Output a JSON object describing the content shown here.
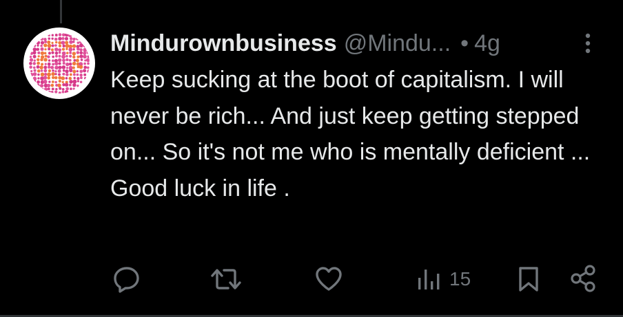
{
  "tweet": {
    "author_name": "Mindurownbusiness",
    "author_handle": "@Mindu...",
    "separator": "•",
    "timestamp": "4g",
    "text": "Keep sucking at the boot of capitalism. I will never be rich... And just keep getting stepped on... So it's not me who is mentally deficient ... Good luck in life ."
  },
  "avatar": {
    "description_icon": "color-blindness-test-plate-icon",
    "colors": [
      "#e0509a",
      "#d63a8a",
      "#f07a3c",
      "#c9407e"
    ]
  },
  "actions": {
    "reply_icon": "reply-icon",
    "retweet_icon": "retweet-icon",
    "like_icon": "heart-icon",
    "views_icon": "views-bar-chart-icon",
    "views_count": "15",
    "bookmark_icon": "bookmark-icon",
    "share_icon": "share-icon"
  },
  "colors": {
    "background": "#000000",
    "text": "#e7e9ea",
    "muted": "#71767b"
  }
}
